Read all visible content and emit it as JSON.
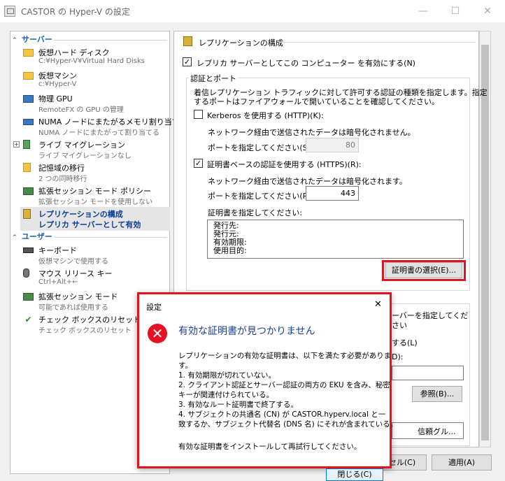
{
  "window": {
    "title": "CASTOR の Hyper-V の設定",
    "minimize": "—",
    "maximize": "☐",
    "close": "✕"
  },
  "sidebar": {
    "server_header": "サーバー",
    "user_header": "ユーザー",
    "server_items": [
      {
        "label": "仮想ハード ディスク",
        "sub": "C:¥Hyper-V¥Virtual Hard Disks",
        "icon": "folder-icon"
      },
      {
        "label": "仮想マシン",
        "sub": "c:¥Hyper-V",
        "icon": "folder-vm-icon"
      },
      {
        "label": "物理 GPU",
        "sub": "RemoteFX の GPU の管理",
        "icon": "gpu-icon"
      },
      {
        "label": "NUMA ノードにまたがるメモリ割り当て",
        "sub": "NUMA ノードにまたがって割り当てる",
        "icon": "numa-icon"
      },
      {
        "label": "ライブ マイグレーション",
        "sub": "ライブ マイグレーションなし",
        "icon": "migration-icon"
      },
      {
        "label": "記憶域の移行",
        "sub": "2 つの同時移行",
        "icon": "storage-icon"
      },
      {
        "label": "拡張セッション モード ポリシー",
        "sub": "拡張セッション モードを使用しない",
        "icon": "session-policy-icon"
      },
      {
        "label": "レプリケーションの構成",
        "sub": "レプリカ サーバーとして有効",
        "icon": "replication-icon"
      }
    ],
    "user_items": [
      {
        "label": "キーボード",
        "sub": "仮想マシンで使用する",
        "icon": "keyboard-icon"
      },
      {
        "label": "マウス リリース キー",
        "sub": "Ctrl+Alt+←",
        "icon": "mouse-icon"
      },
      {
        "label": "拡張セッション モード",
        "sub": "可能であれば使用する",
        "icon": "session-icon"
      },
      {
        "label": "チェック ボックスのリセット",
        "sub": "チェック ボックスのリセット",
        "icon": "checkbox-reset-icon"
      }
    ]
  },
  "panel": {
    "section_title": "レプリケーションの構成",
    "enable_label": "レプリカ サーバーとしてこの コンピューター を有効にする(N)",
    "auth_group": "認証とポート",
    "auth_desc1": "着信レプリケーション トラフィックに対して許可する認証の種類を指定します。指定",
    "auth_desc2": "するポートはファイアウォールで開いていることを確認してください。",
    "kerberos_label": "Kerberos を使用する (HTTP)(K):",
    "kerberos_note": "ネットワーク経由で送信されたデータは暗号化されません。",
    "kerberos_port_label": "ポートを指定してください(S):",
    "kerberos_port": "80",
    "cert_label": "証明書ベースの認証を使用する (HTTPS)(R):",
    "cert_note": "ネットワーク経由で送信されたデータは暗号化されます。",
    "cert_port_label": "ポートを指定してください(P):",
    "cert_port": "443",
    "cert_spec_label": "証明書を指定してください:",
    "cert_fields": [
      "発行先:",
      "発行元:",
      "有効期限:",
      "使用目的:"
    ],
    "cert_select_button": "証明書の選択(E)...",
    "auth_server_partial": "ーバーを指定してくだ",
    "d_partial": "さい",
    "radio_partial": "する(L)",
    "d_label_partial": "D):",
    "browse_button": "参照(B)...",
    "trust_partial": "信頼グル..."
  },
  "footer": {
    "cancel_partial": "セル(C)",
    "apply": "適用(A)"
  },
  "dialog": {
    "title": "設定",
    "close": "✕",
    "heading": "有効な証明書が見つかりません",
    "lines": [
      "レプリケーションの有効な証明書は、以下を満たす必要がありま",
      "す。",
      "1. 有効期限が切れていない。",
      "2. クライアント認証とサーバー認証の両方の EKU を含み、秘密",
      "キーが関連付けられている。",
      "3. 有効なルート証明書で終了する。",
      "4. サブジェクトの共通名 (CN) が CASTOR.hyperv.local と一",
      "致するか、サブジェクト代替名 (DNS 名) にそれが含まれている。",
      "",
      "有効な証明書をインストールして再試行してください。"
    ],
    "close_button": "閉じる(C)"
  },
  "colors": {
    "accent": "#1c5fb5",
    "highlight": "#e0131e",
    "error": "#e81123"
  }
}
